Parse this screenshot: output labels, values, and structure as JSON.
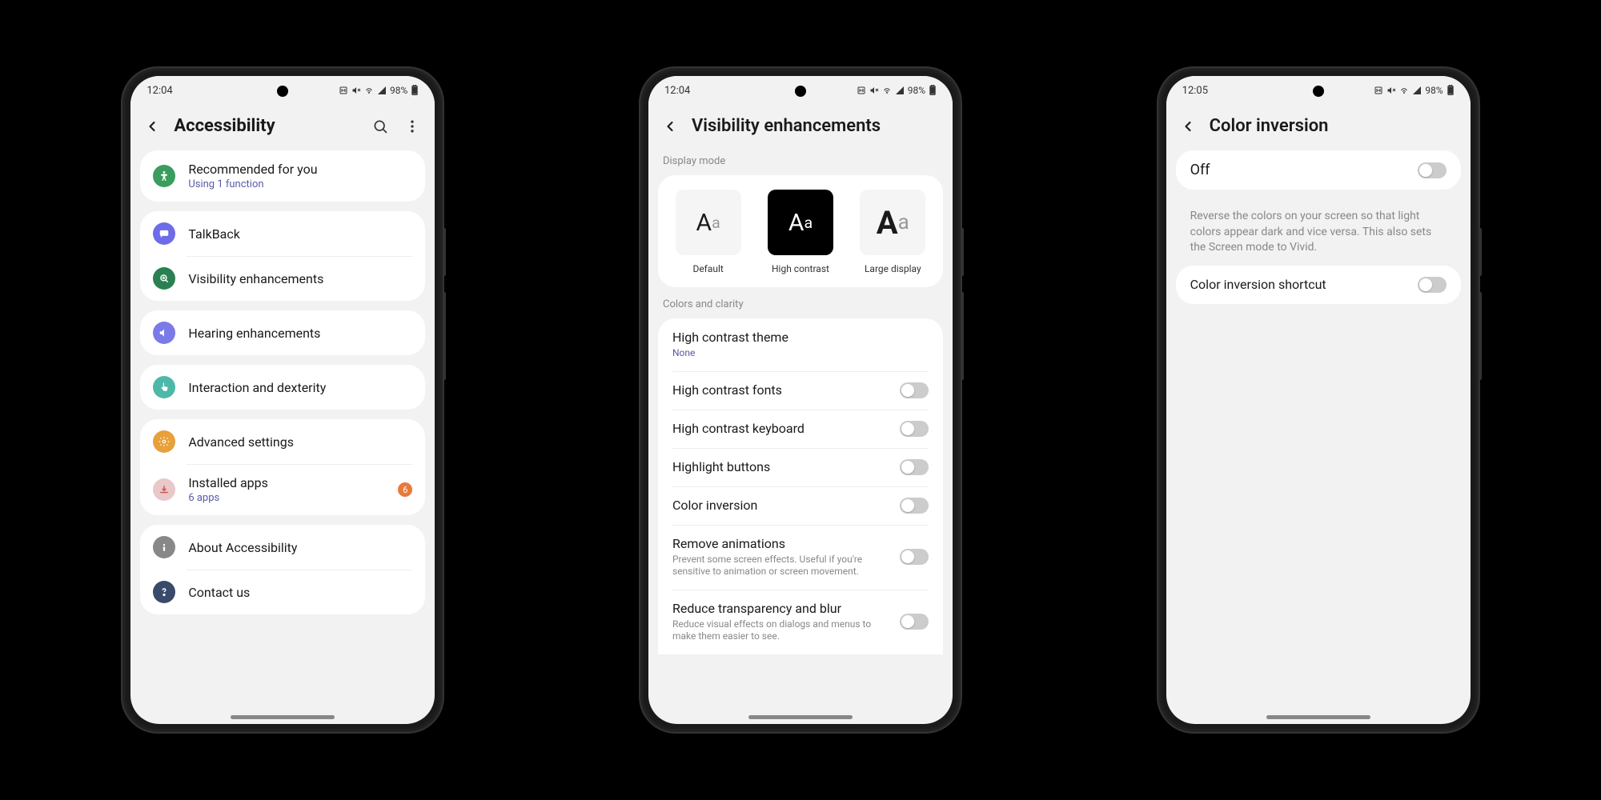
{
  "status": {
    "time1": "12:04",
    "time2": "12:04",
    "time3": "12:05",
    "battery": "98%",
    "icons": "ℕ 🔕 ⚡ 📶"
  },
  "screen1": {
    "title": "Accessibility",
    "items": {
      "recommended": {
        "label": "Recommended for you",
        "sub": "Using 1 function"
      },
      "talkback": {
        "label": "TalkBack"
      },
      "visibility": {
        "label": "Visibility enhancements"
      },
      "hearing": {
        "label": "Hearing enhancements"
      },
      "interaction": {
        "label": "Interaction and dexterity"
      },
      "advanced": {
        "label": "Advanced settings"
      },
      "installed": {
        "label": "Installed apps",
        "sub": "6 apps",
        "badge": "6"
      },
      "about": {
        "label": "About Accessibility"
      },
      "contact": {
        "label": "Contact us"
      }
    }
  },
  "screen2": {
    "title": "Visibility enhancements",
    "section1": "Display mode",
    "modes": {
      "default": "Default",
      "hc": "High contrast",
      "large": "Large display"
    },
    "section2": "Colors and clarity",
    "rows": {
      "hctheme": {
        "label": "High contrast theme",
        "sub": "None"
      },
      "hcfonts": {
        "label": "High contrast fonts"
      },
      "hckeyboard": {
        "label": "High contrast keyboard"
      },
      "highlight": {
        "label": "Highlight buttons"
      },
      "inversion": {
        "label": "Color inversion"
      },
      "anim": {
        "label": "Remove animations",
        "sub": "Prevent some screen effects. Useful if you're sensitive to animation or screen movement."
      },
      "blur": {
        "label": "Reduce transparency and blur",
        "sub": "Reduce visual effects on dialogs and menus to make them easier to see."
      }
    }
  },
  "screen3": {
    "title": "Color inversion",
    "off": "Off",
    "desc": "Reverse the colors on your screen so that light colors appear dark and vice versa. This also sets the Screen mode to Vivid.",
    "shortcut": "Color inversion shortcut"
  }
}
